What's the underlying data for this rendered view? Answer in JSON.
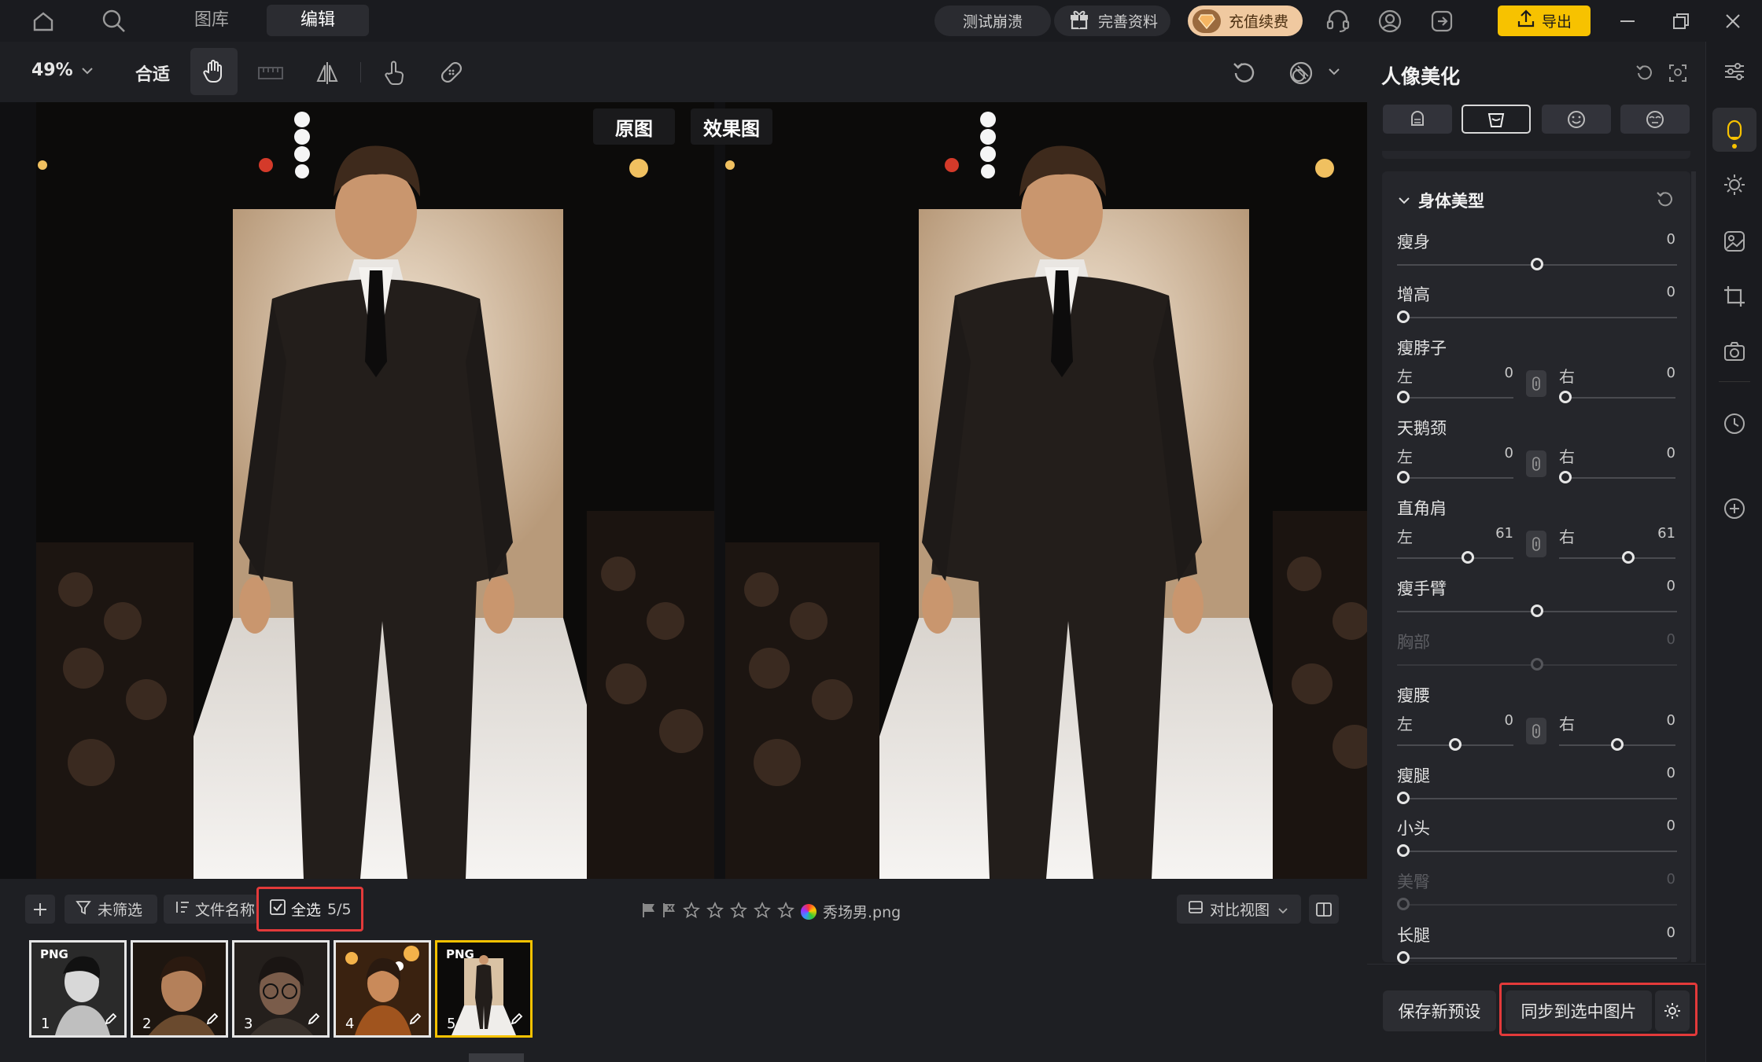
{
  "topnav": {
    "tabs": [
      {
        "label": "图库"
      },
      {
        "label": "编辑"
      }
    ],
    "feedback_button": "测试崩溃",
    "complete_profile_button": "完善资料",
    "recharge_button": "充值续费",
    "export_button": "导出"
  },
  "toolbar": {
    "zoom": "49%",
    "fit_button": "合适"
  },
  "canvas": {
    "before_label": "原图",
    "after_label": "效果图"
  },
  "filmstrip": {
    "filter_button": "未筛选",
    "sort_button": "文件名称",
    "select_all_label": "全选",
    "select_count": "5/5",
    "filename": "秀场男.png",
    "view_mode": "对比视图",
    "thumbnails": [
      {
        "number": "1",
        "tag": "PNG"
      },
      {
        "number": "2",
        "tag": ""
      },
      {
        "number": "3",
        "tag": ""
      },
      {
        "number": "4",
        "tag": ""
      },
      {
        "number": "5",
        "tag": "PNG"
      }
    ]
  },
  "panel": {
    "title": "人像美化",
    "section_title": "身体美型",
    "sliders": {
      "slim_body": {
        "label": "瘦身",
        "value": "0"
      },
      "height": {
        "label": "增高",
        "value": "0"
      },
      "slim_neck": {
        "label": "瘦脖子",
        "left_label": "左",
        "left_value": "0",
        "right_label": "右",
        "right_value": "0"
      },
      "swan_neck": {
        "label": "天鹅颈",
        "left_label": "左",
        "left_value": "0",
        "right_label": "右",
        "right_value": "0"
      },
      "square_shoulder": {
        "label": "直角肩",
        "left_label": "左",
        "left_value": "61",
        "right_label": "右",
        "right_value": "61"
      },
      "slim_arm": {
        "label": "瘦手臂",
        "value": "0"
      },
      "chest": {
        "label": "胸部",
        "value": "0"
      },
      "slim_waist": {
        "label": "瘦腰",
        "left_label": "左",
        "left_value": "0",
        "right_label": "右",
        "right_value": "0"
      },
      "slim_leg": {
        "label": "瘦腿",
        "value": "0"
      },
      "small_head": {
        "label": "小头",
        "value": "0"
      },
      "hip": {
        "label": "美臀",
        "value": "0"
      },
      "long_leg": {
        "label": "长腿",
        "value": "0"
      }
    },
    "save_preset_button": "保存新预设",
    "sync_button": "同步到选中图片"
  },
  "colors": {
    "accent": "#f7c200",
    "highlight": "#e33a3a",
    "recharge": "#f0c9a0"
  }
}
